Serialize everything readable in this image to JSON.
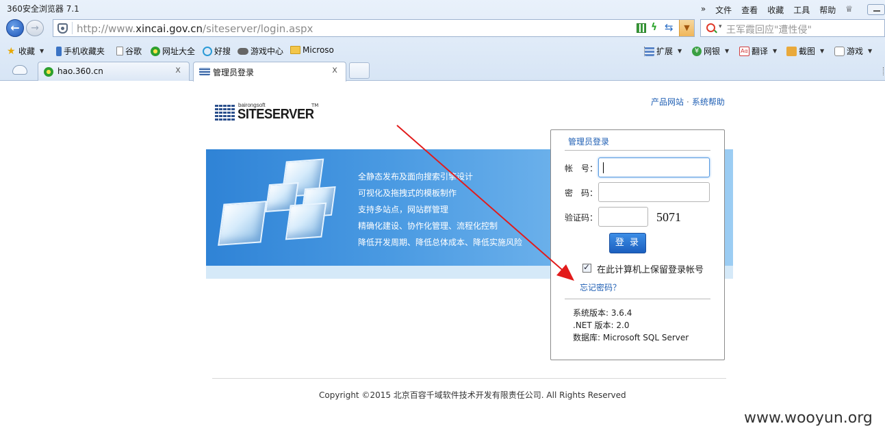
{
  "browser": {
    "app_title": "360安全浏览器 7.1",
    "menu": [
      "»",
      "文件",
      "查看",
      "收藏",
      "工具",
      "帮助"
    ],
    "url_prefix": "http://www.",
    "url_domain": "xincai.gov.cn",
    "url_path": "/siteserver/login.aspx",
    "search_text": "王军霞回应\"遭性侵\"",
    "favorites": [
      {
        "label": "收藏",
        "icon": "star-icon"
      },
      {
        "label": "手机收藏夹",
        "icon": "phone-icon"
      },
      {
        "label": "谷歌",
        "icon": "page-icon"
      },
      {
        "label": "网址大全",
        "icon": "360-icon"
      },
      {
        "label": "好搜",
        "icon": "haosou-icon"
      },
      {
        "label": "游戏中心",
        "icon": "gamepad-icon"
      },
      {
        "label": "Microso",
        "icon": "folder-icon"
      }
    ],
    "extensions": [
      {
        "label": "扩展",
        "icon": "grid-icon"
      },
      {
        "label": "网银",
        "icon": "yen-icon"
      },
      {
        "label": "翻译",
        "icon": "translate-icon"
      },
      {
        "label": "截图",
        "icon": "scissors-icon"
      },
      {
        "label": "游戏",
        "icon": "game-icon"
      }
    ],
    "tabs": [
      {
        "label": "hao.360.cn",
        "close": "x"
      },
      {
        "label": "管理员登录",
        "close": "x"
      }
    ]
  },
  "page": {
    "logo_small": "bairongsoft",
    "logo_big": "SITESERVER",
    "logo_tm": "TM",
    "top_links": {
      "product": "产品网站",
      "sep": "·",
      "help": "系统帮助"
    },
    "banner_lines": [
      "全静态发布及面向搜索引擎设计",
      "可视化及拖拽式的模板制作",
      "支持多站点，网站群管理",
      "精确化建设、协作化管理、流程化控制",
      "降低开发周期、降低总体成本、降低实施风险"
    ],
    "login": {
      "title": "管理员登录",
      "account_label": "帐　号：",
      "account_value": "",
      "password_label": "密　码：",
      "password_value": "",
      "captcha_label": "验证码：",
      "captcha_value": "",
      "captcha_code": "5071",
      "submit": "登 录",
      "remember_label": "在此计算机上保留登录帐号",
      "remember_checked": true,
      "forgot": "忘记密码？",
      "version": "系统版本: 3.6.4",
      "net_version": ".NET 版本: 2.0",
      "database": "数据库: Microsoft SQL Server"
    },
    "copyright": "Copyright ©2015 北京百容千域软件技术开发有限责任公司. All Rights Reserved",
    "watermark": "www.wooyun.org"
  },
  "colors": {
    "link": "#1f5fb4",
    "banner": "#3a8ad9",
    "arrow": "#e21b1b"
  }
}
